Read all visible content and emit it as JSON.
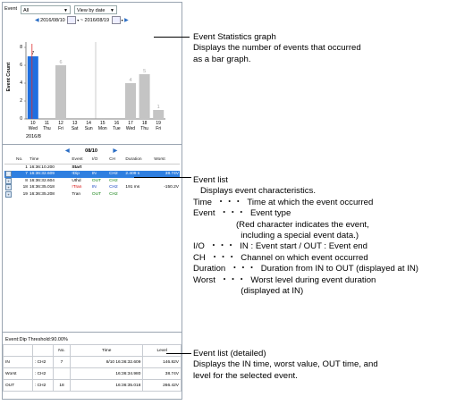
{
  "toolbar": {
    "event_label": "Event",
    "event_value": "All",
    "view_value": "View by date"
  },
  "date_range": {
    "from": "2016/08/10",
    "to": "2016/08/19"
  },
  "chart_data": {
    "type": "bar",
    "ylabel": "Event Count",
    "ylim": [
      0,
      8
    ],
    "yticks": [
      "0",
      "2",
      "4",
      "6",
      "8"
    ],
    "x_dates": [
      "10",
      "11",
      "12",
      "13",
      "14",
      "15",
      "16",
      "17",
      "18",
      "19"
    ],
    "x_days": [
      "Wed",
      "Thu",
      "Fri",
      "Sat",
      "Sun",
      "Mon",
      "Tue",
      "Wed",
      "Thu",
      "Fri"
    ],
    "values": [
      7,
      0,
      6,
      0,
      0,
      0,
      0,
      4,
      5,
      1
    ],
    "value_labels": [
      "7",
      "",
      "6",
      "",
      "",
      "",
      "",
      "4",
      "5",
      "1"
    ],
    "selected_index": 0,
    "month_label": "2016/8",
    "colors": {
      "selected": "#1f6fe0",
      "normal": "#c4c4c4",
      "marker": "#e03030"
    }
  },
  "list_nav": {
    "date": "08/10"
  },
  "event_list": {
    "headers": [
      "No.",
      "Time",
      "Event",
      "I/O",
      "CH",
      "Duration",
      "Worst"
    ],
    "rows": [
      {
        "no": "1",
        "time": "16:36:10.200",
        "event": "Start",
        "io": "",
        "ch": "",
        "duration": "",
        "worst": "",
        "expand": false,
        "selected": false,
        "special": false
      },
      {
        "no": "7",
        "time": "16:36:32.609",
        "event": "!Dip",
        "io": "IN",
        "ch": "CH2",
        "duration": "2.409 s",
        "worst": "38.74V",
        "expand": true,
        "selected": true,
        "special": true
      },
      {
        "no": "8",
        "time": "16:36:32.604",
        "event": "Uthd",
        "io": "OUT",
        "ch": "CH2",
        "duration": "",
        "worst": "",
        "expand": true,
        "selected": false,
        "special": false
      },
      {
        "no": "18",
        "time": "16:36:35.018",
        "event": "!Tran",
        "io": "IN",
        "ch": "CH2",
        "duration": "191 ms",
        "worst": "-150.2V",
        "expand": true,
        "selected": false,
        "special": true
      },
      {
        "no": "19",
        "time": "16:36:35.208",
        "event": "Tran",
        "io": "OUT",
        "ch": "CH2",
        "duration": "",
        "worst": "",
        "expand": true,
        "selected": false,
        "special": false
      }
    ]
  },
  "detail": {
    "caption": "Event:Dip   Threshold:90.00%",
    "headers": [
      "No.",
      "Time",
      "Level"
    ],
    "rows": [
      {
        "label": "IN",
        "ch": ": CH2",
        "no": "7",
        "time": "8/10 16:36:32.609",
        "level": "146.82V"
      },
      {
        "label": "Worst",
        "ch": ": CH2",
        "no": "",
        "time": "16:36:34.980",
        "level": "38.74V"
      },
      {
        "label": "OUT",
        "ch": ": CH2",
        "no": "18",
        "time": "16:36:35.018",
        "level": "266.42V"
      }
    ]
  },
  "annotations": {
    "graph": [
      "Event Statistics graph",
      "Displays the number of events that occurred",
      "as a bar graph."
    ],
    "list": [
      "Event list",
      "   Displays event characteristics.",
      "Time  ・・・  Time at which the event occurred",
      "Event  ・・・  Event type",
      "                  (Red character indicates the event,",
      "                    including a special event data.)",
      "I/O  ・・・  IN : Event start / OUT : Event end",
      "CH  ・・・  Channel on which event occurred",
      "Duration  ・・・  Duration from IN to OUT (displayed at IN)",
      "Worst  ・・・  Worst level during event duration",
      "                    (displayed at IN)"
    ],
    "detail": [
      "Event list (detailed)",
      "Displays the IN time, worst value, OUT time, and",
      "level for the selected event."
    ]
  }
}
